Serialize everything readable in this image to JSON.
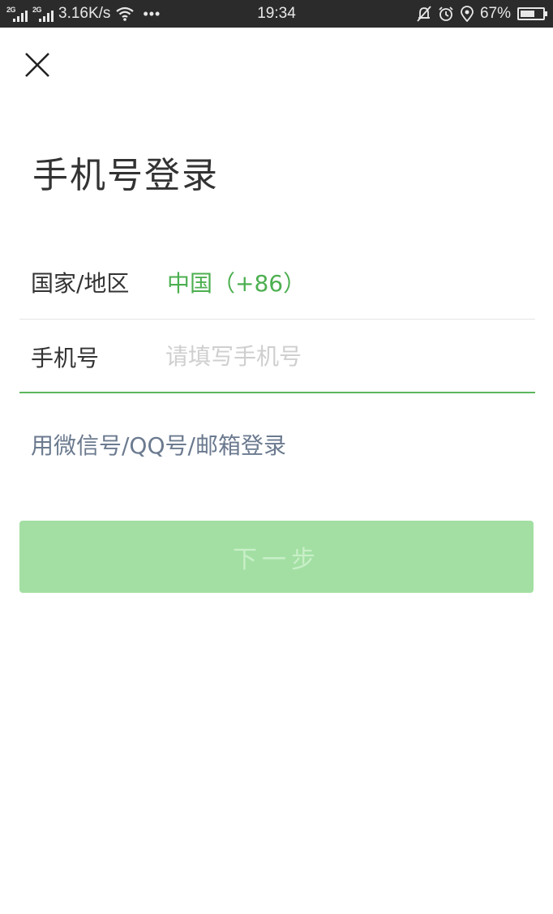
{
  "status_bar": {
    "sim1_tag": "2G",
    "sim2_tag": "2G",
    "net_speed": "3.16K/s",
    "dots": "•••",
    "time": "19:34",
    "battery_percent_text": "67%",
    "battery_level": 0.67,
    "icons": [
      "signal-icon",
      "wifi-icon",
      "mute-icon",
      "alarm-icon",
      "location-icon",
      "battery-icon"
    ]
  },
  "page": {
    "close_icon": "close-icon",
    "title": "手机号登录",
    "country_label": "国家/地区",
    "country_value": "中国（+86）",
    "phone_label": "手机号",
    "phone_placeholder": "请填写手机号",
    "phone_value": "",
    "alt_login": "用微信号/QQ号/邮箱登录",
    "next_button": "下一步"
  },
  "colors": {
    "accent": "#4caf50",
    "button_disabled_bg": "#a3dfa3",
    "status_bar_bg": "#2b2b2b"
  }
}
